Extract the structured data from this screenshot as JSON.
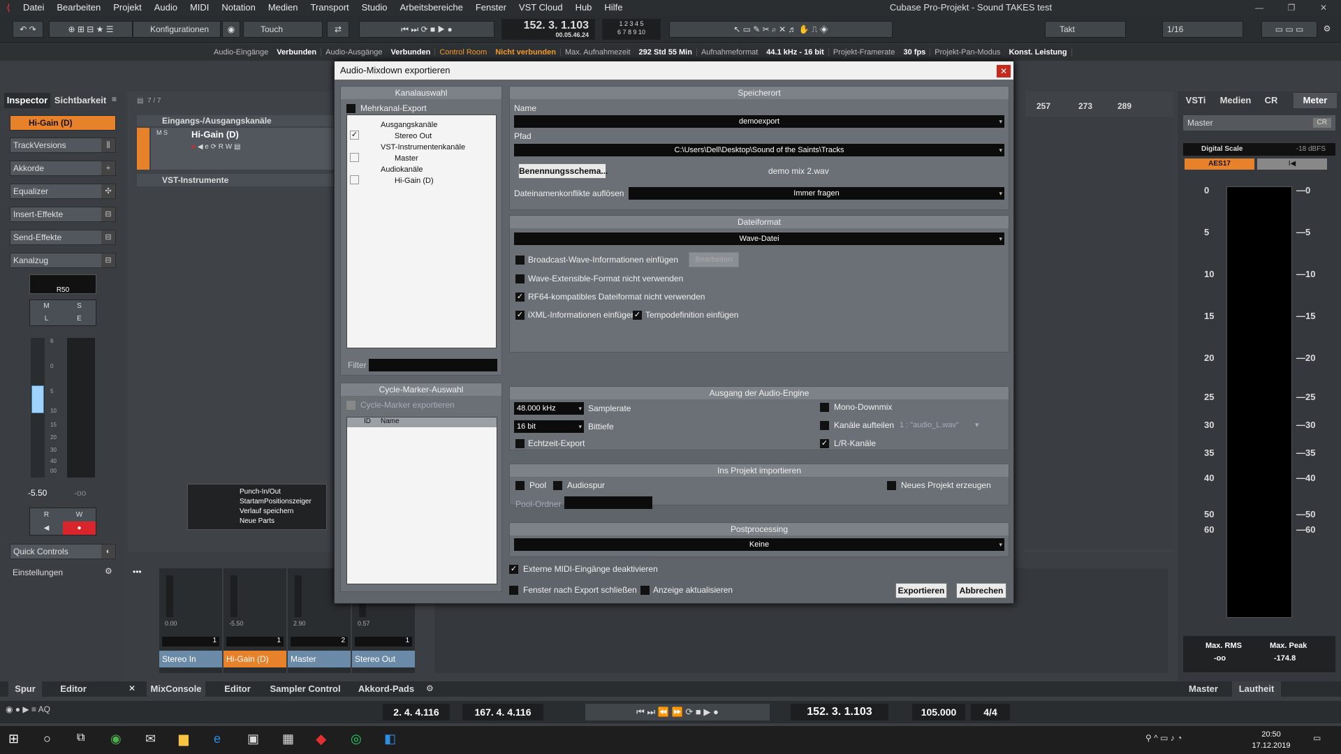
{
  "titlebar": {
    "menus": [
      "Datei",
      "Bearbeiten",
      "Projekt",
      "Audio",
      "MIDI",
      "Notation",
      "Medien",
      "Transport",
      "Studio",
      "Arbeitsbereiche",
      "Fenster",
      "VST Cloud",
      "Hub",
      "Hilfe"
    ],
    "window_title": "Cubase Pro-Projekt - Sound TAKES test"
  },
  "toolbar": {
    "config_label": "Konfigurationen",
    "touch_label": "Touch",
    "position_main": "152. 3. 1.103",
    "position_time": "00.05.46.24",
    "grid_label": "Takt",
    "quantize_label": "1/16"
  },
  "statusbar": {
    "items": [
      {
        "label": "Audio-Eingänge",
        "value": "Verbunden"
      },
      {
        "label": "Audio-Ausgänge",
        "value": "Verbunden"
      },
      {
        "label": "Control Room",
        "value": "Nicht verbunden"
      },
      {
        "label": "Max. Aufnahmezeit",
        "value": "292 Std 55 Min"
      },
      {
        "label": "Aufnahmeformat",
        "value": "44.1 kHz - 16 bit"
      },
      {
        "label": "Projekt-Framerate",
        "value": "30 fps"
      },
      {
        "label": "Projekt-Pan-Modus",
        "value": "Konst. Leistung"
      }
    ]
  },
  "inspector": {
    "tabs": [
      "Inspector",
      "Sichtbarkeit"
    ],
    "track_name": "Hi-Gain (D)",
    "sections": [
      "TrackVersions",
      "Akkorde",
      "Equalizer",
      "Insert-Effekte",
      "Send-Effekte",
      "Kanalzug"
    ],
    "pan_value": "R50",
    "volume_value": "-5.50",
    "volume_inf": "-oo",
    "quick_controls": "Quick Controls",
    "settings": "Einstellungen",
    "fader_scale": [
      "6",
      "0",
      "5",
      "10",
      "15",
      "20",
      "30",
      "40",
      "00"
    ]
  },
  "tracks": {
    "count": "7 / 7",
    "folder1": "Eingangs-/Ausgangskanäle",
    "track1": "Hi-Gain (D)",
    "folder2": "VST-Instrumente",
    "popup": [
      "Punch-In/Out",
      "StartamPositionszeiger",
      "Verlauf speichern",
      "Neue Parts"
    ]
  },
  "ruler": [
    "257",
    "273",
    "289"
  ],
  "right_zone": {
    "tabs": [
      "VSTi",
      "Medien",
      "CR",
      "Meter"
    ],
    "channel": "Master",
    "cr_btn": "CR",
    "scale_label": "Digital Scale",
    "scale_value": "-18 dBFS",
    "aes_btn": "AES17",
    "meter_scale": [
      "0",
      "5",
      "10",
      "15",
      "20",
      "25",
      "30",
      "35",
      "40",
      "50",
      "60"
    ],
    "max_rms_label": "Max. RMS",
    "max_rms": "-oo",
    "max_peak_label": "Max. Peak",
    "max_peak": "-174.8",
    "bottom_tabs": [
      "Master",
      "Lautheit"
    ]
  },
  "mixer": {
    "channels": [
      {
        "name": "Stereo In",
        "num": "1",
        "val": "0.00"
      },
      {
        "name": "Hi-Gain (D)",
        "num": "1",
        "val": "-5.50"
      },
      {
        "name": "Master",
        "num": "2",
        "val": "2.90"
      },
      {
        "name": "Stereo Out",
        "num": "1",
        "val": "0.57"
      }
    ]
  },
  "lower_tabs": {
    "left": [
      "Spur",
      "Editor"
    ],
    "main": [
      "MixConsole",
      "Editor",
      "Sampler Control",
      "Akkord-Pads"
    ]
  },
  "transport": {
    "left_locator": "2. 4. 4.116",
    "right_locator": "167. 4. 4.116",
    "position": "152. 3. 1.103",
    "tempo": "105.000",
    "signature": "4/4"
  },
  "taskbar": {
    "time": "20:50",
    "date": "17.12.2019"
  },
  "dialog": {
    "title": "Audio-Mixdown exportieren",
    "channel_selection": {
      "heading": "Kanalauswahl",
      "multichannel": "Mehrkanal-Export",
      "tree": [
        "Ausgangskanäle",
        "Stereo Out",
        "VST-Instrumentenkanäle",
        "Master",
        "Audiokanäle",
        "Hi-Gain (D)"
      ],
      "filter_label": "Filter"
    },
    "cycle_marker": {
      "heading": "Cycle-Marker-Auswahl",
      "export": "Cycle-Marker exportieren",
      "col_id": "ID",
      "col_name": "Name"
    },
    "location": {
      "heading": "Speicherort",
      "name_label": "Name",
      "name_value": "demoexport",
      "path_label": "Pfad",
      "path_value": "C:\\Users\\Dell\\Desktop\\Sound of the Saints\\Tracks",
      "naming_btn": "Benennungsschema...",
      "file_preview": "demo mix 2.wav",
      "conflict_label": "Dateinamenkonflikte auflösen",
      "conflict_value": "Immer fragen"
    },
    "file_format": {
      "heading": "Dateiformat",
      "format": "Wave-Datei",
      "bwf": "Broadcast-Wave-Informationen einfügen",
      "edit_btn": "Bearbeiten",
      "wave_ext": "Wave-Extensible-Format nicht verwenden",
      "rf64": "RF64-kompatibles Dateiformat nicht verwenden",
      "ixml": "iXML-Informationen einfügen",
      "tempo": "Tempodefinition einfügen"
    },
    "engine_output": {
      "heading": "Ausgang der Audio-Engine",
      "samplerate_value": "48.000 kHz",
      "samplerate_label": "Samplerate",
      "bitdepth_value": "16 bit",
      "bitdepth_label": "Bittiefe",
      "realtime": "Echtzeit-Export",
      "mono": "Mono-Downmix",
      "split": "Kanäle aufteilen",
      "split_value": "1 : \"audio_L.wav\"",
      "lr": "L/R-Kanäle"
    },
    "import": {
      "heading": "Ins Projekt importieren",
      "pool": "Pool",
      "audiotrack": "Audiospur",
      "new_project": "Neues Projekt erzeugen",
      "pool_folder": "Pool-Ordner"
    },
    "post": {
      "heading": "Postprocessing",
      "value": "Keine"
    },
    "ext_midi": "Externe MIDI-Eingänge deaktivieren",
    "close_after": "Fenster nach Export schließen",
    "update_display": "Anzeige aktualisieren",
    "export_btn": "Exportieren",
    "cancel_btn": "Abbrechen"
  }
}
